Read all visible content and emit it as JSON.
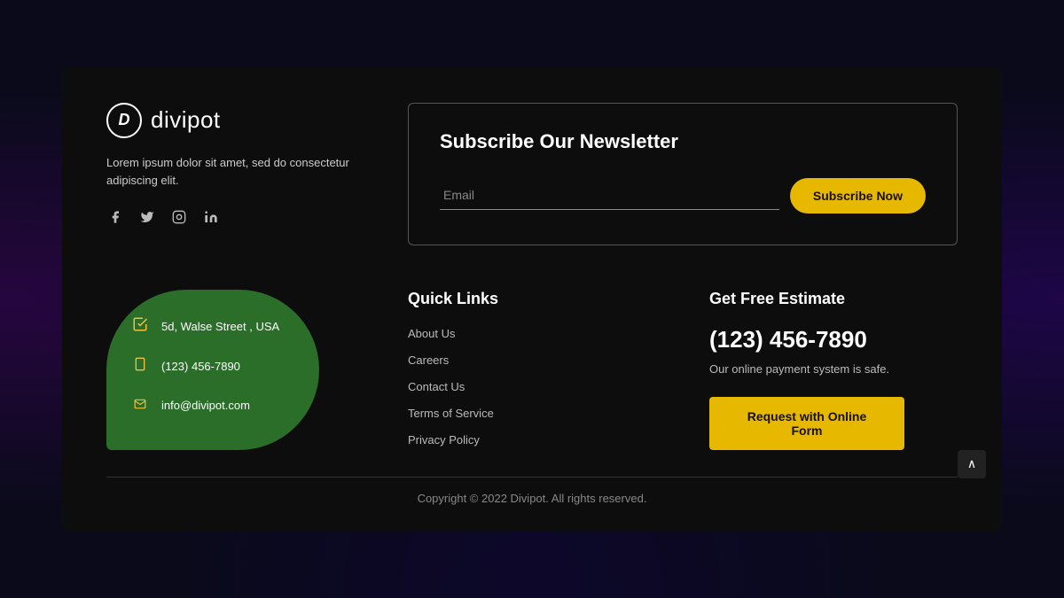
{
  "background": {
    "color": "#0a0a1a"
  },
  "brand": {
    "logo_letter": "D",
    "logo_name": "divipot",
    "description": "Lorem ipsum dolor sit amet, sed do consectetur adipiscing elit.",
    "social": [
      {
        "name": "facebook",
        "icon": "f",
        "unicode": "🇫"
      },
      {
        "name": "twitter",
        "icon": "t"
      },
      {
        "name": "instagram",
        "icon": "📷"
      },
      {
        "name": "linkedin",
        "icon": "in"
      }
    ]
  },
  "newsletter": {
    "title": "Subscribe Our Newsletter",
    "email_placeholder": "Email",
    "button_label": "Subscribe Now"
  },
  "contact": {
    "address": "5d, Walse Street , USA",
    "phone": "(123) 456-7890",
    "email": "info@divipot.com"
  },
  "quick_links": {
    "title": "Quick Links",
    "items": [
      {
        "label": "About Us",
        "href": "#"
      },
      {
        "label": "Careers",
        "href": "#"
      },
      {
        "label": "Contact Us",
        "href": "#"
      },
      {
        "label": "Terms of Service",
        "href": "#"
      },
      {
        "label": "Privacy Policy",
        "href": "#"
      }
    ]
  },
  "estimate": {
    "title": "Get Free Estimate",
    "phone": "(123) 456-7890",
    "description": "Our online payment system is safe.",
    "button_label": "Request with Online Form"
  },
  "footer": {
    "copyright": "Copyright © 2022 Divipot. All rights reserved."
  },
  "scroll_top": {
    "icon": "∧"
  }
}
